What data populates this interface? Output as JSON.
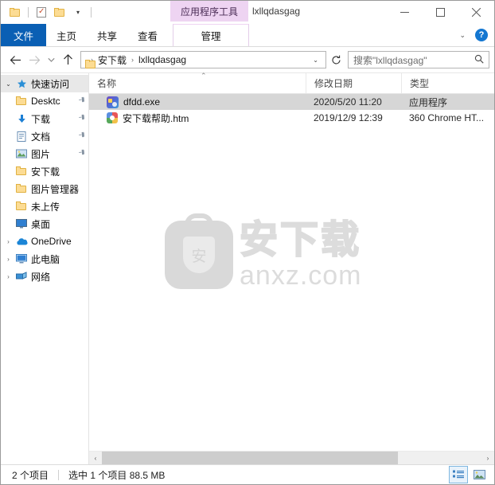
{
  "window": {
    "title": "lxllqdasgag",
    "contextual_tab_group": "应用程序工具",
    "controls": {
      "minimize": "—",
      "maximize": "□",
      "close": "✕"
    }
  },
  "quick_access_toolbar": {
    "items": [
      {
        "name": "folder-properties-icon",
        "label": "属性"
      },
      {
        "name": "new-folder-icon",
        "label": "新建文件夹"
      }
    ],
    "customize_caret": "▾"
  },
  "ribbon": {
    "tabs": [
      {
        "id": "file",
        "label": "文件",
        "selected": true
      },
      {
        "id": "home",
        "label": "主页",
        "selected": false
      },
      {
        "id": "share",
        "label": "共享",
        "selected": false
      },
      {
        "id": "view",
        "label": "查看",
        "selected": false
      },
      {
        "id": "manage",
        "label": "管理",
        "selected": false,
        "contextual": true
      }
    ],
    "expand_caret": "⌄",
    "help_label": "?"
  },
  "address_bar": {
    "back": "←",
    "forward": "→",
    "recent": "⌄",
    "up": "↑",
    "breadcrumb": [
      {
        "label": "安下载"
      },
      {
        "label": "lxllqdasgag"
      }
    ],
    "crumb_separator": "›",
    "dropdown_caret": "⌄",
    "refresh": "↻",
    "search_placeholder": "搜索\"lxllqdasgag\"",
    "search_icon": "🔍"
  },
  "sidebar": {
    "items": [
      {
        "label": "快速访问",
        "icon": "star-pin-icon",
        "level": 0,
        "expanded": true,
        "chevron": "⌄",
        "header": true,
        "pinned": false
      },
      {
        "label": "Desktc",
        "icon": "folder-icon",
        "level": 1,
        "pinned": true
      },
      {
        "label": "下载",
        "icon": "download-icon",
        "level": 1,
        "pinned": true
      },
      {
        "label": "文档",
        "icon": "documents-icon",
        "level": 1,
        "pinned": true
      },
      {
        "label": "图片",
        "icon": "pictures-icon",
        "level": 1,
        "pinned": true
      },
      {
        "label": "安下载",
        "icon": "folder-icon",
        "level": 1,
        "pinned": false
      },
      {
        "label": "图片管理器",
        "icon": "folder-icon",
        "level": 1,
        "pinned": false
      },
      {
        "label": "未上传",
        "icon": "folder-icon",
        "level": 1,
        "pinned": false
      },
      {
        "label": "桌面",
        "icon": "desktop-icon",
        "level": 1,
        "pinned": false
      },
      {
        "label": "OneDrive",
        "icon": "onedrive-cloud-icon",
        "level": 0,
        "expanded": false,
        "chevron": "›"
      },
      {
        "label": "此电脑",
        "icon": "this-pc-icon",
        "level": 0,
        "expanded": false,
        "chevron": "›"
      },
      {
        "label": "网络",
        "icon": "network-icon",
        "level": 0,
        "expanded": false,
        "chevron": "›"
      }
    ],
    "pin_glyph": "📌"
  },
  "file_list": {
    "columns": [
      {
        "key": "name",
        "label": "名称",
        "sorted": "asc",
        "sort_glyph": "⌃"
      },
      {
        "key": "date",
        "label": "修改日期"
      },
      {
        "key": "type",
        "label": "类型"
      }
    ],
    "rows": [
      {
        "name": "dfdd.exe",
        "date": "2020/5/20 11:20",
        "type": "应用程序",
        "icon": "exe-file-icon",
        "selected": true
      },
      {
        "name": "安下载帮助.htm",
        "date": "2019/12/9 12:39",
        "type": "360 Chrome HT...",
        "icon": "html-file-icon",
        "selected": false
      }
    ]
  },
  "watermark": {
    "brand_cn": "安下载",
    "brand_url": "anxz.com",
    "shield_char": "安"
  },
  "scrollbar": {
    "left_arrow": "‹",
    "right_arrow": "›"
  },
  "status_bar": {
    "item_count": "2 个项目",
    "selection": "选中 1 个项目  88.5 MB",
    "views": [
      {
        "name": "details-view-button",
        "active": true
      },
      {
        "name": "large-icons-view-button",
        "active": false
      }
    ]
  },
  "colors": {
    "file_tab_blue": "#0a5fb4",
    "contextual_purple": "#eed4f2",
    "selection_gray": "#d6d6d6",
    "help_blue": "#1477d1",
    "folder_yellow": "#fcdc94"
  }
}
